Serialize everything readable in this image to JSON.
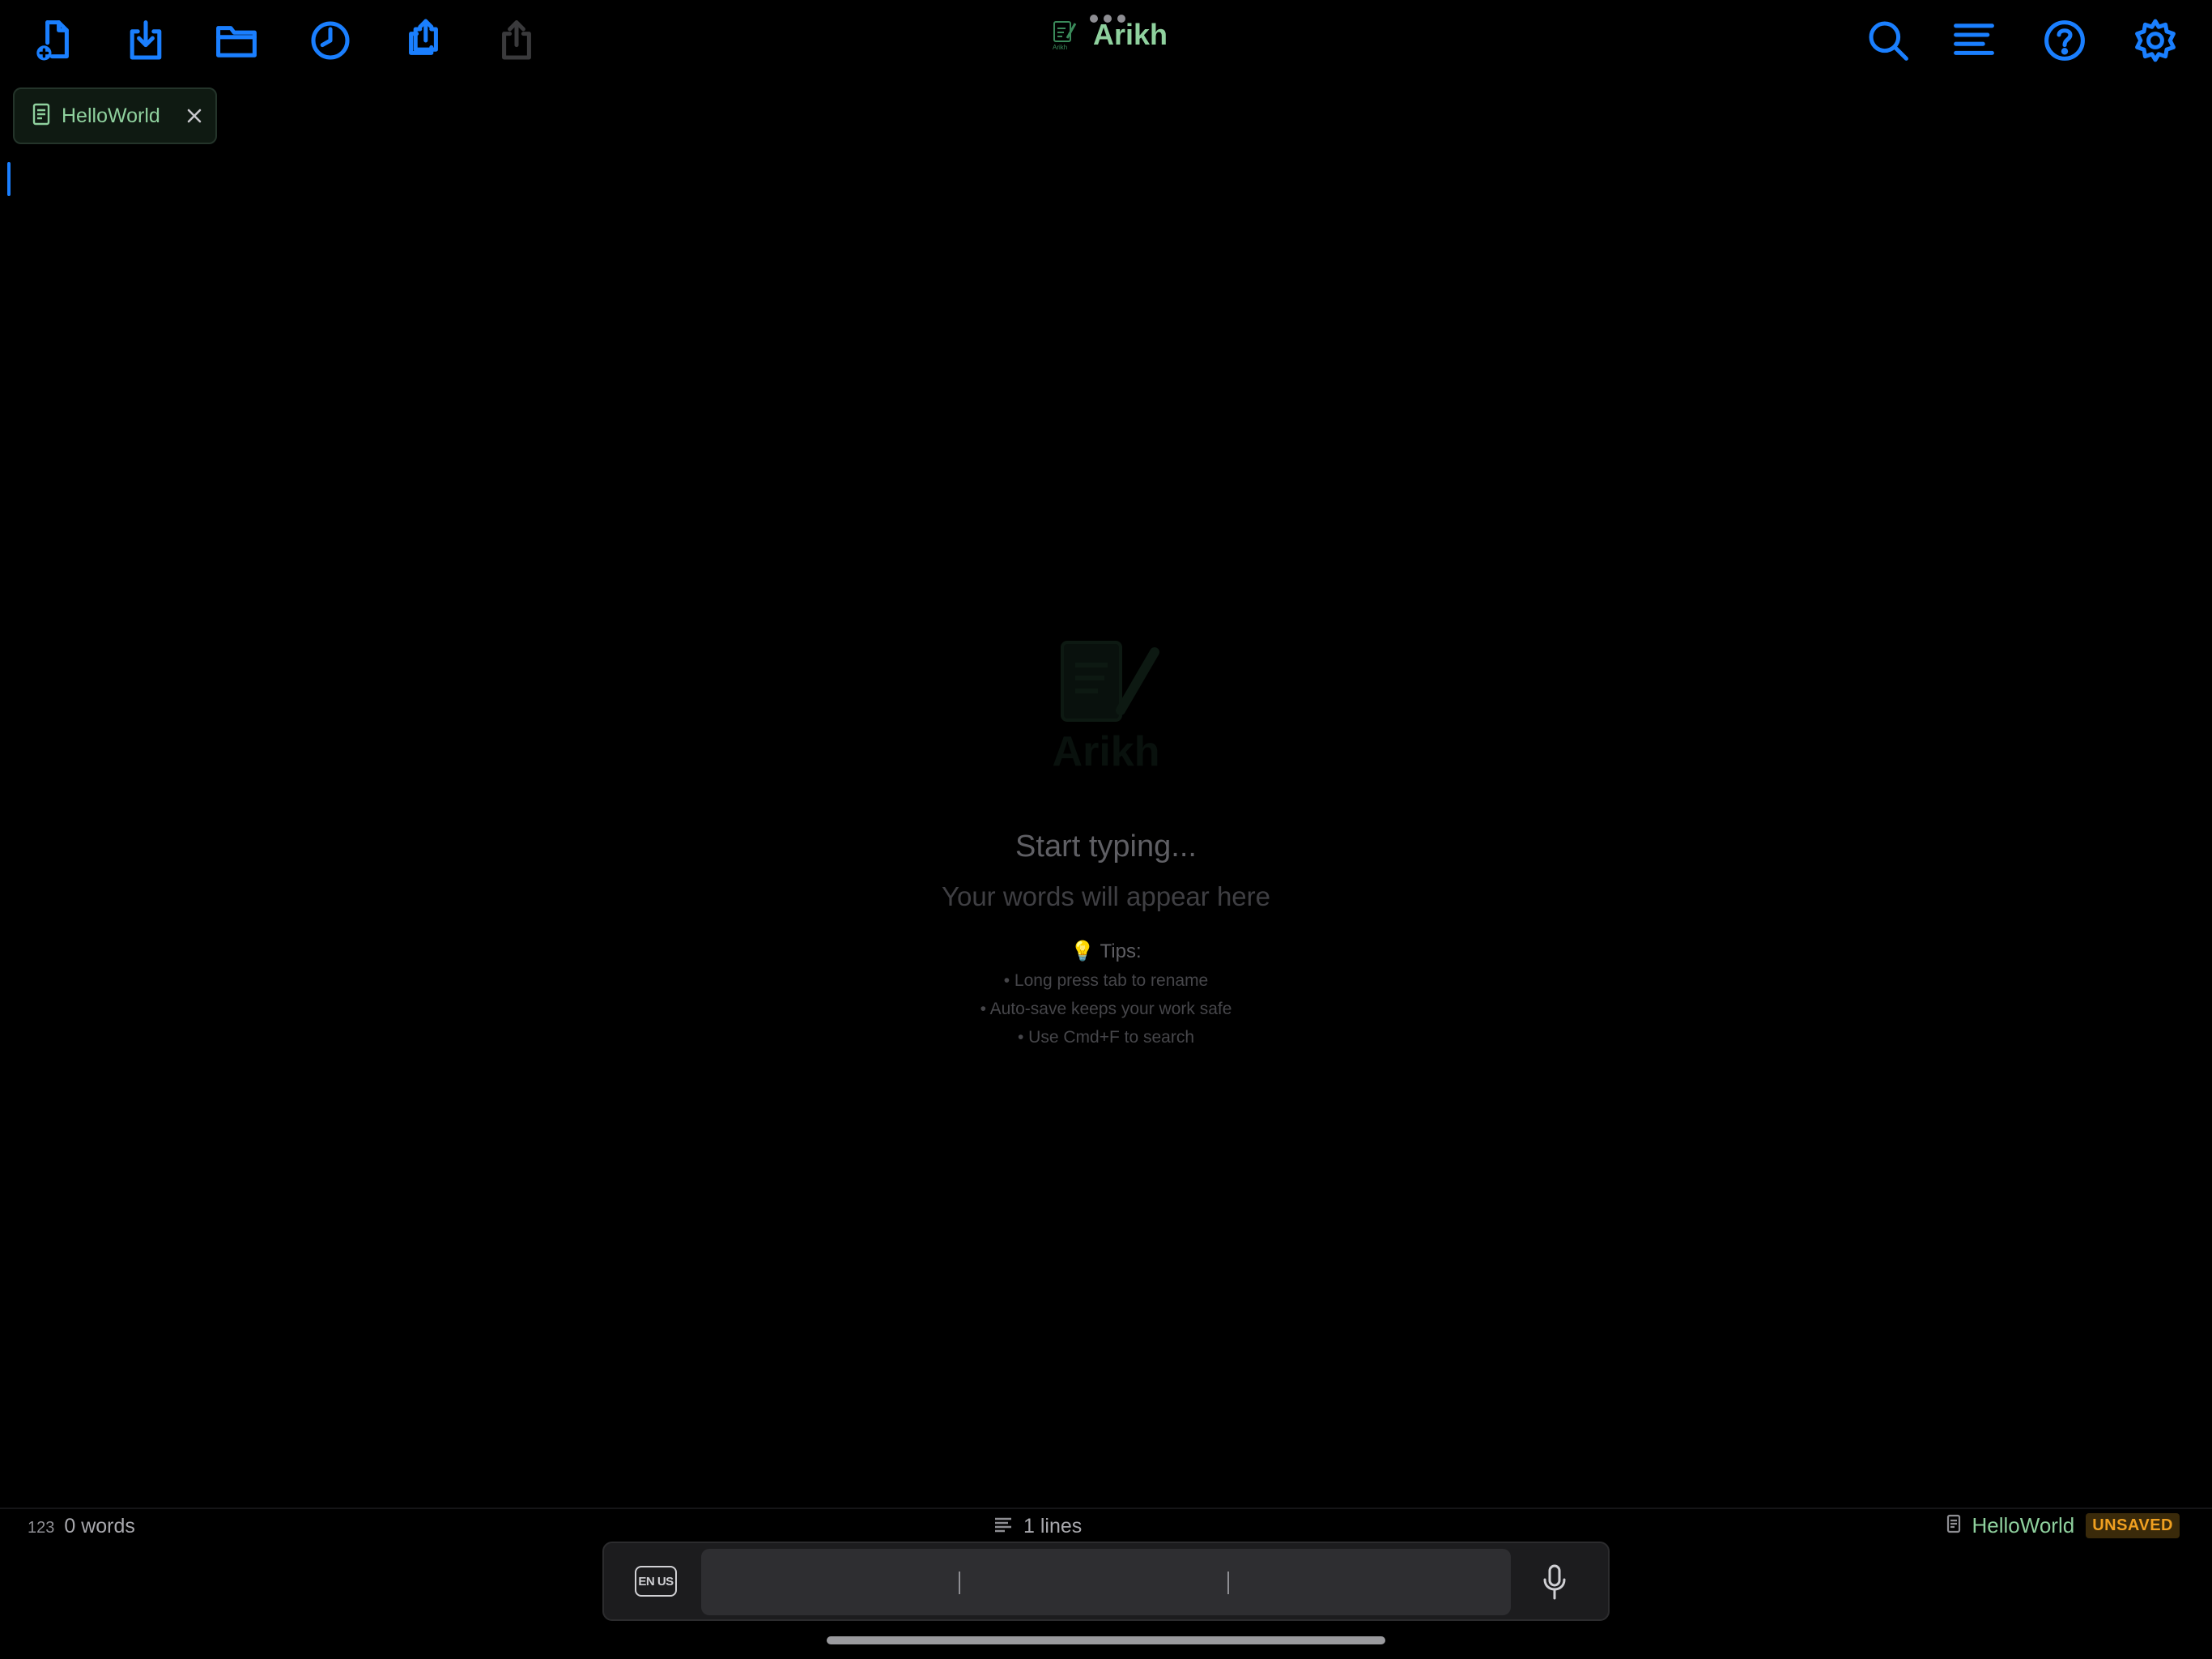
{
  "app": {
    "title": "Arikh"
  },
  "tab": {
    "label": "HelloWorld"
  },
  "empty_state": {
    "watermark_text": "Arikh",
    "heading": "Start typing...",
    "subheading": "Your words will appear here",
    "tips_title": "💡 Tips:",
    "tips": [
      "• Long press tab to rename",
      "• Auto-save keeps your work safe",
      "• Use Cmd+F to search"
    ]
  },
  "status": {
    "counter_prefix": "123",
    "words": "0 words",
    "lines": "1 lines",
    "file_name": "HelloWorld",
    "badge": "UNSAVED"
  },
  "keyboard": {
    "language": "EN US"
  },
  "colors": {
    "accent": "#1a7fff",
    "brand_green": "#8fd19e",
    "unsaved": "#f0a020",
    "background": "#000000"
  },
  "icons": {
    "toolbar_left": [
      "new-file-icon",
      "download-icon",
      "folder-icon",
      "history-icon",
      "share-copy-icon",
      "share-icon"
    ],
    "toolbar_right": [
      "search-icon",
      "outline-icon",
      "help-icon",
      "settings-icon"
    ]
  }
}
